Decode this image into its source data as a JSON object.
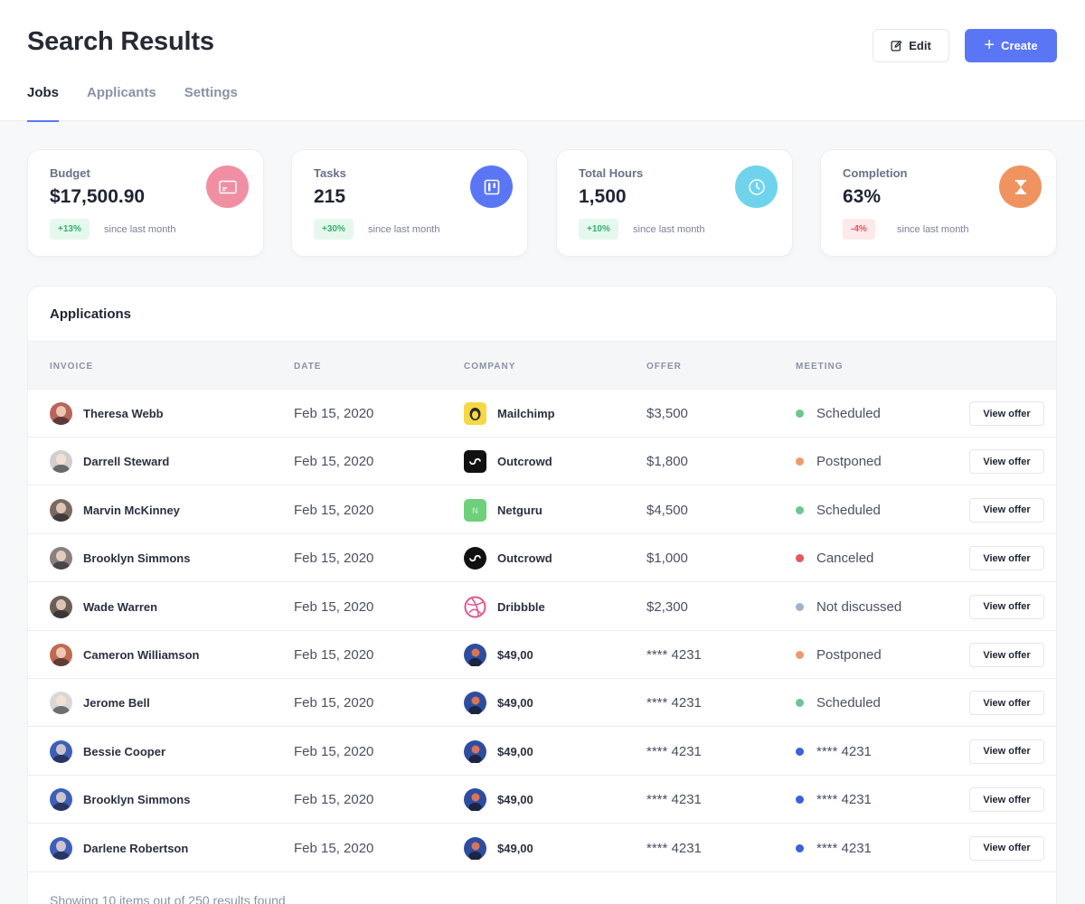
{
  "header": {
    "title": "Search Results",
    "edit_label": "Edit",
    "create_label": "Create",
    "tabs": [
      {
        "label": "Jobs",
        "active": true
      },
      {
        "label": "Applicants",
        "active": false
      },
      {
        "label": "Settings",
        "active": false
      }
    ]
  },
  "stats": [
    {
      "label": "Budget",
      "value": "$17,500.90",
      "change": "+13%",
      "note": "since last month",
      "icon": "credit-card-icon",
      "color": "#f08fa3",
      "trend": "up"
    },
    {
      "label": "Tasks",
      "value": "215",
      "change": "+30%",
      "note": "since last month",
      "icon": "kanban-board-icon",
      "color": "#5b76f5",
      "trend": "up"
    },
    {
      "label": "Total Hours",
      "value": "1,500",
      "change": "+10%",
      "note": "since last month",
      "icon": "clock-icon",
      "color": "#6fd3ec",
      "trend": "up"
    },
    {
      "label": "Completion",
      "value": "63%",
      "change": "-4%",
      "note": "since last month",
      "icon": "hourglass-icon",
      "color": "#ef9461",
      "trend": "down"
    }
  ],
  "table": {
    "title": "Applications",
    "columns": [
      "INVOICE",
      "DATE",
      "COMPANY",
      "OFFER",
      "MEETING"
    ],
    "action_label": "View offer",
    "rows": [
      {
        "name": "Theresa Webb",
        "date": "Feb 15, 2020",
        "company": "Mailchimp",
        "logo": "mailchimp",
        "offer": "$3,500",
        "meeting": "Scheduled",
        "dot": "#6cc593",
        "avatar": "#b6655b"
      },
      {
        "name": "Darrell Steward",
        "date": "Feb 15, 2020",
        "company": "Outcrowd",
        "logo": "outcrowd-square",
        "offer": "$1,800",
        "meeting": "Postponed",
        "dot": "#ef9a6d",
        "avatar": "#cfcfcf"
      },
      {
        "name": "Marvin McKinney",
        "date": "Feb 15, 2020",
        "company": "Netguru",
        "logo": "netguru",
        "offer": "$4,500",
        "meeting": "Scheduled",
        "dot": "#6cc593",
        "avatar": "#7a6a62"
      },
      {
        "name": "Brooklyn Simmons",
        "date": "Feb 15, 2020",
        "company": "Outcrowd",
        "logo": "outcrowd-circle",
        "offer": "$1,000",
        "meeting": "Canceled",
        "dot": "#e5575e",
        "avatar": "#8a807d"
      },
      {
        "name": "Wade Warren",
        "date": "Feb 15, 2020",
        "company": "Dribbble",
        "logo": "dribbble",
        "offer": "$2,300",
        "meeting": "Not discussed",
        "dot": "#a4b2c9",
        "avatar": "#6c5d56"
      },
      {
        "name": "Cameron Williamson",
        "date": "Feb 15, 2020",
        "company": "$49,00",
        "logo": "photo",
        "offer": "**** 4231",
        "meeting": "Postponed",
        "dot": "#ef9a6d",
        "avatar": "#c06a52"
      },
      {
        "name": "Jerome Bell",
        "date": "Feb 15, 2020",
        "company": "$49,00",
        "logo": "photo",
        "offer": "**** 4231",
        "meeting": "Scheduled",
        "dot": "#6cc593",
        "avatar": "#d8d8d8"
      },
      {
        "name": "Bessie Cooper",
        "date": "Feb 15, 2020",
        "company": "$49,00",
        "logo": "photo",
        "offer": "**** 4231",
        "meeting": "**** 4231",
        "dot": "#3d5fe0",
        "avatar": "#3d5fb8"
      },
      {
        "name": "Brooklyn Simmons",
        "date": "Feb 15, 2020",
        "company": "$49,00",
        "logo": "photo",
        "offer": "**** 4231",
        "meeting": "**** 4231",
        "dot": "#3d5fe0",
        "avatar": "#3d5fb8"
      },
      {
        "name": "Darlene Robertson",
        "date": "Feb 15, 2020",
        "company": "$49,00",
        "logo": "photo",
        "offer": "**** 4231",
        "meeting": "**** 4231",
        "dot": "#3d5fe0",
        "avatar": "#3d5fb8"
      }
    ],
    "footer": "Showing 10 items out of 250 results found"
  }
}
